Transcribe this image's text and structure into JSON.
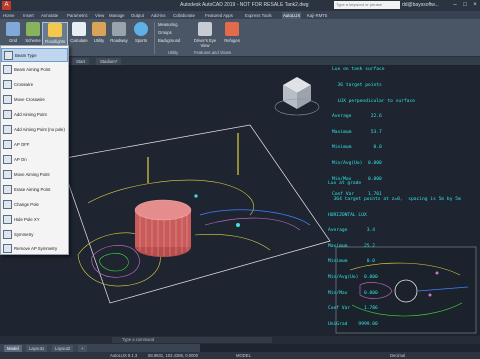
{
  "titlebar": {
    "title": "Autodesk AutoCAD 2019 - NOT FOR RESALE   Tank2.dwg",
    "search_placeholder": "Type a keyword or phrase",
    "user": "dd@bayssoftw..."
  },
  "ribbon_tabs": [
    "Home",
    "Insert",
    "Annotate",
    "Parametric",
    "View",
    "Manage",
    "Output",
    "Add-ins",
    "Collaborate",
    "Featured Apps",
    "Express Tools",
    "AutoLUX",
    "Kaji-RMT5"
  ],
  "ribbon_tab_active": "AutoLUX",
  "ribbon": {
    "buttons": [
      "Grid",
      "Scheme",
      "Floodlights",
      "Calculate",
      "Utility",
      "Roadway",
      "Sports"
    ],
    "small": [
      "Measuring",
      "Groups",
      "Background",
      "Driver's Eye View",
      "Refuges"
    ],
    "panel_labels": [
      "AutoLUX",
      "Utility",
      "Features and Views"
    ]
  },
  "doc_tabs": [
    "Start",
    "Stadium*"
  ],
  "menu": {
    "items": [
      "Beam Type",
      "Beam Aiming Point",
      "Crosswire",
      "Move Crosswire",
      "Add Aiming Point",
      "Add Aiming Point (no pole)",
      "AP OFF",
      "AP On",
      "Move Aiming Point",
      "Erase Aiming Point",
      "Change Pole",
      "Hide Pole XY",
      "Symmetry",
      "Remove AP Symmetry"
    ],
    "highlighted": "Beam Type"
  },
  "panel_top": {
    "lines": [
      "Lux on tank surface",
      "  36 target points",
      "  LUX perpendicular to surface",
      "Average       22.6",
      "Maximum       53.7",
      "Minimum        0.0",
      "Min/Avg(Uo)  0.000",
      "Min/Max      0.000",
      "Coef Var     1.701"
    ]
  },
  "panel_grade": {
    "lines": [
      "Lux at grade",
      "  364 target points at z=0,  spacing is 5m by 5m",
      "HORIZONTAL LUX",
      "Average       3.4",
      "Maximum      25.2",
      "Minimum       0.0",
      "Min/Avg(Uo)  0.000",
      "Min/Max      0.000",
      "Coef Var     1.786",
      "UniGrad    9999.00"
    ]
  },
  "cmdline_placeholder": "Type a command",
  "layout_tabs": [
    "Model",
    "Layout1",
    "Layout2"
  ],
  "status": {
    "app": "AutoLUX 9.1.3",
    "coords": "58.9831, 102.4286, 0.0000",
    "mode": "MODEL",
    "units": "Decimal"
  },
  "colors": {
    "viewport_bg": "#1f2530",
    "cyan_text": "#28e0e8",
    "green_text": "#3cf03c",
    "tank_red": "#e06a6a"
  }
}
